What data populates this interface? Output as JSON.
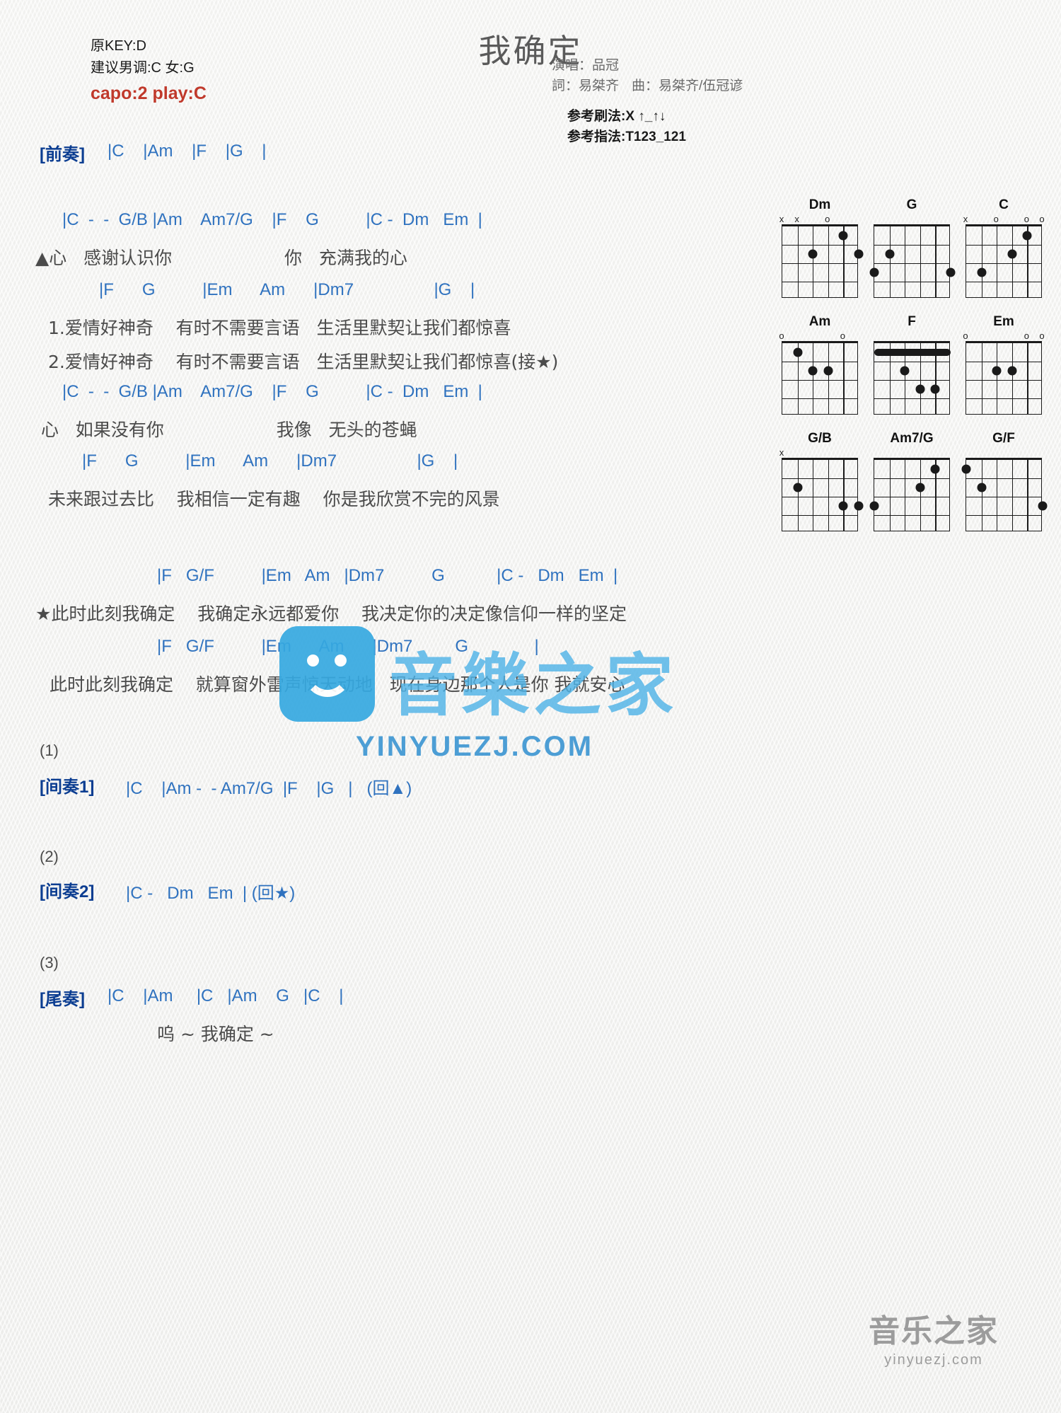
{
  "header": {
    "orig_key": "原KEY:D",
    "suggest_key": "建议男调:C 女:G",
    "capo": "capo:2 play:C",
    "title": "我确定",
    "singer": "演唱：品冠",
    "lyricist": "詞：易桀齐",
    "composer": "曲：易桀齐/伍冠谚",
    "strum": "参考刷法:X ↑_↑↓",
    "fingerstyle": "参考指法:T123_121"
  },
  "sections": {
    "intro_label": "[前奏]",
    "intro_chords": "|C    |Am    |F    |G    |",
    "interlude1_label": "[间奏1]",
    "interlude1_chords": "|C    |Am -  - Am7/G  |F    |G   |   (回▲)",
    "interlude2_label": "[间奏2]",
    "interlude2_chords": "|C -   Dm   Em  | (回★)",
    "outro_label": "[尾奏]",
    "outro_chords": "|C    |Am     |C   |Am    G   |C    |",
    "outro_lyric": "呜 ~ 我确定 ~",
    "num1": "(1)",
    "num2": "(2)",
    "num3": "(3)"
  },
  "verse": {
    "c1": "|C  -  -  G/B |Am    Am7/G    |F    G          |C -  Dm   Em  |",
    "l1": "▲心   感谢认识你                    你   充满我的心",
    "c2": "|F      G          |Em      Am      |Dm7                 |G    |",
    "l2a": "1.爱情好神奇    有时不需要言语   生活里默契让我们都惊喜",
    "l2b": "2.爱情好神奇    有时不需要言语   生活里默契让我们都惊喜(接★)",
    "c3": "|C  -  -  G/B |Am    Am7/G    |F    G          |C -  Dm   Em  |",
    "l3": " 心   如果没有你                    我像   无头的苍蝇",
    "c4": "|F      G          |Em      Am      |Dm7                 |G    |",
    "l4": "未来跟过去比    我相信一定有趣    你是我欣赏不完的风景"
  },
  "chorus": {
    "c1": "|F   G/F          |Em   Am   |Dm7          G           |C -   Dm   Em  |",
    "l1": "★此时此刻我确定    我确定永远都爱你    我决定你的决定像信仰一样的坚定",
    "c2": "|F   G/F          |Em      Am      |Dm7         G              |",
    "l2": " 此时此刻我确定    就算窗外雷声惊天动地   现在身边那个人是你 我就安心"
  },
  "chord_diagrams": [
    {
      "name": "Dm",
      "marks": [
        {
          "sym": "x",
          "string": 1
        },
        {
          "sym": "x",
          "string": 2
        },
        {
          "sym": "o",
          "string": 4
        }
      ],
      "dots": [
        {
          "string": 3,
          "fret": 2
        },
        {
          "string": 5,
          "fret": 1
        },
        {
          "string": 6,
          "fret": 2
        }
      ],
      "barre": null
    },
    {
      "name": "G",
      "marks": [],
      "dots": [
        {
          "string": 1,
          "fret": 3
        },
        {
          "string": 2,
          "fret": 2
        },
        {
          "string": 6,
          "fret": 3
        }
      ],
      "barre": null
    },
    {
      "name": "C",
      "marks": [
        {
          "sym": "x",
          "string": 1
        },
        {
          "sym": "o",
          "string": 3
        },
        {
          "sym": "o",
          "string": 5
        },
        {
          "sym": "o",
          "string": 6
        }
      ],
      "dots": [
        {
          "string": 2,
          "fret": 3
        },
        {
          "string": 4,
          "fret": 2
        },
        {
          "string": 5,
          "fret": 1
        }
      ],
      "barre": null
    },
    {
      "name": "Am",
      "marks": [
        {
          "sym": "o",
          "string": 1
        },
        {
          "sym": "o",
          "string": 5
        }
      ],
      "dots": [
        {
          "string": 3,
          "fret": 2
        },
        {
          "string": 4,
          "fret": 2
        },
        {
          "string": 2,
          "fret": 1
        }
      ],
      "barre": null
    },
    {
      "name": "F",
      "marks": [],
      "dots": [
        {
          "string": 3,
          "fret": 2
        },
        {
          "string": 4,
          "fret": 3
        },
        {
          "string": 5,
          "fret": 3
        }
      ],
      "barre": {
        "fret": 1,
        "from": 1,
        "to": 6
      }
    },
    {
      "name": "Em",
      "marks": [
        {
          "sym": "o",
          "string": 1
        },
        {
          "sym": "o",
          "string": 5
        },
        {
          "sym": "o",
          "string": 6
        }
      ],
      "dots": [
        {
          "string": 3,
          "fret": 2
        },
        {
          "string": 4,
          "fret": 2
        }
      ],
      "barre": null
    },
    {
      "name": "G/B",
      "marks": [
        {
          "sym": "x",
          "string": 1
        }
      ],
      "dots": [
        {
          "string": 2,
          "fret": 2
        },
        {
          "string": 5,
          "fret": 3
        },
        {
          "string": 6,
          "fret": 3
        }
      ],
      "barre": null
    },
    {
      "name": "Am7/G",
      "marks": [],
      "dots": [
        {
          "string": 1,
          "fret": 3
        },
        {
          "string": 4,
          "fret": 2
        },
        {
          "string": 5,
          "fret": 1
        }
      ],
      "barre": null
    },
    {
      "name": "G/F",
      "marks": [],
      "dots": [
        {
          "string": 1,
          "fret": 1
        },
        {
          "string": 2,
          "fret": 2
        },
        {
          "string": 6,
          "fret": 3
        }
      ],
      "barre": null
    }
  ],
  "watermark": {
    "cn": "音樂之家",
    "url": "YINYUEZJ.COM",
    "footer_cn": "音乐之家",
    "footer_url": "yinyuezj.com"
  }
}
